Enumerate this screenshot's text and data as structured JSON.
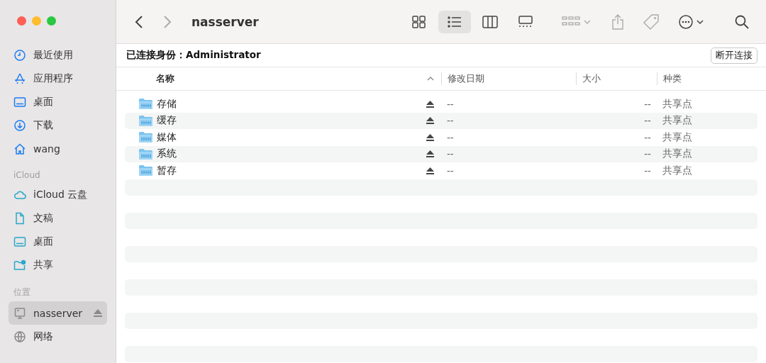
{
  "sidebar": {
    "sections": [
      {
        "items": [
          {
            "label": "最近使用",
            "selected": false,
            "ejectable": false
          },
          {
            "label": "应用程序",
            "selected": false,
            "ejectable": false
          },
          {
            "label": "桌面",
            "selected": false,
            "ejectable": false
          },
          {
            "label": "下载",
            "selected": false,
            "ejectable": false
          },
          {
            "label": "wang",
            "selected": false,
            "ejectable": false
          }
        ]
      },
      {
        "heading": "iCloud",
        "items": [
          {
            "label": "iCloud 云盘",
            "selected": false,
            "ejectable": false
          },
          {
            "label": "文稿",
            "selected": false,
            "ejectable": false
          },
          {
            "label": "桌面",
            "selected": false,
            "ejectable": false
          },
          {
            "label": "共享",
            "selected": false,
            "ejectable": false
          }
        ]
      },
      {
        "heading": "位置",
        "items": [
          {
            "label": "nasserver",
            "selected": true,
            "ejectable": true
          },
          {
            "label": "网络",
            "selected": false,
            "ejectable": false
          }
        ]
      }
    ]
  },
  "toolbar": {
    "title": "nasserver",
    "views": [
      {
        "selected": false
      },
      {
        "selected": true
      },
      {
        "selected": false
      },
      {
        "selected": false
      }
    ]
  },
  "connection_bar": {
    "label": "已连接身份：",
    "user": "Administrator",
    "button": "断开连接"
  },
  "table": {
    "columns": [
      {
        "label": "名称",
        "sorted": true
      },
      {
        "label": "修改日期",
        "sorted": false
      },
      {
        "label": "大小",
        "sorted": false
      },
      {
        "label": "种类",
        "sorted": false
      }
    ],
    "rows": [
      {
        "name": "存储",
        "date": "--",
        "size": "--",
        "kind": "共享点"
      },
      {
        "name": "缓存",
        "date": "--",
        "size": "--",
        "kind": "共享点"
      },
      {
        "name": "媒体",
        "date": "--",
        "size": "--",
        "kind": "共享点"
      },
      {
        "name": "系统",
        "date": "--",
        "size": "--",
        "kind": "共享点"
      },
      {
        "name": "暂存",
        "date": "--",
        "size": "--",
        "kind": "共享点"
      }
    ]
  }
}
